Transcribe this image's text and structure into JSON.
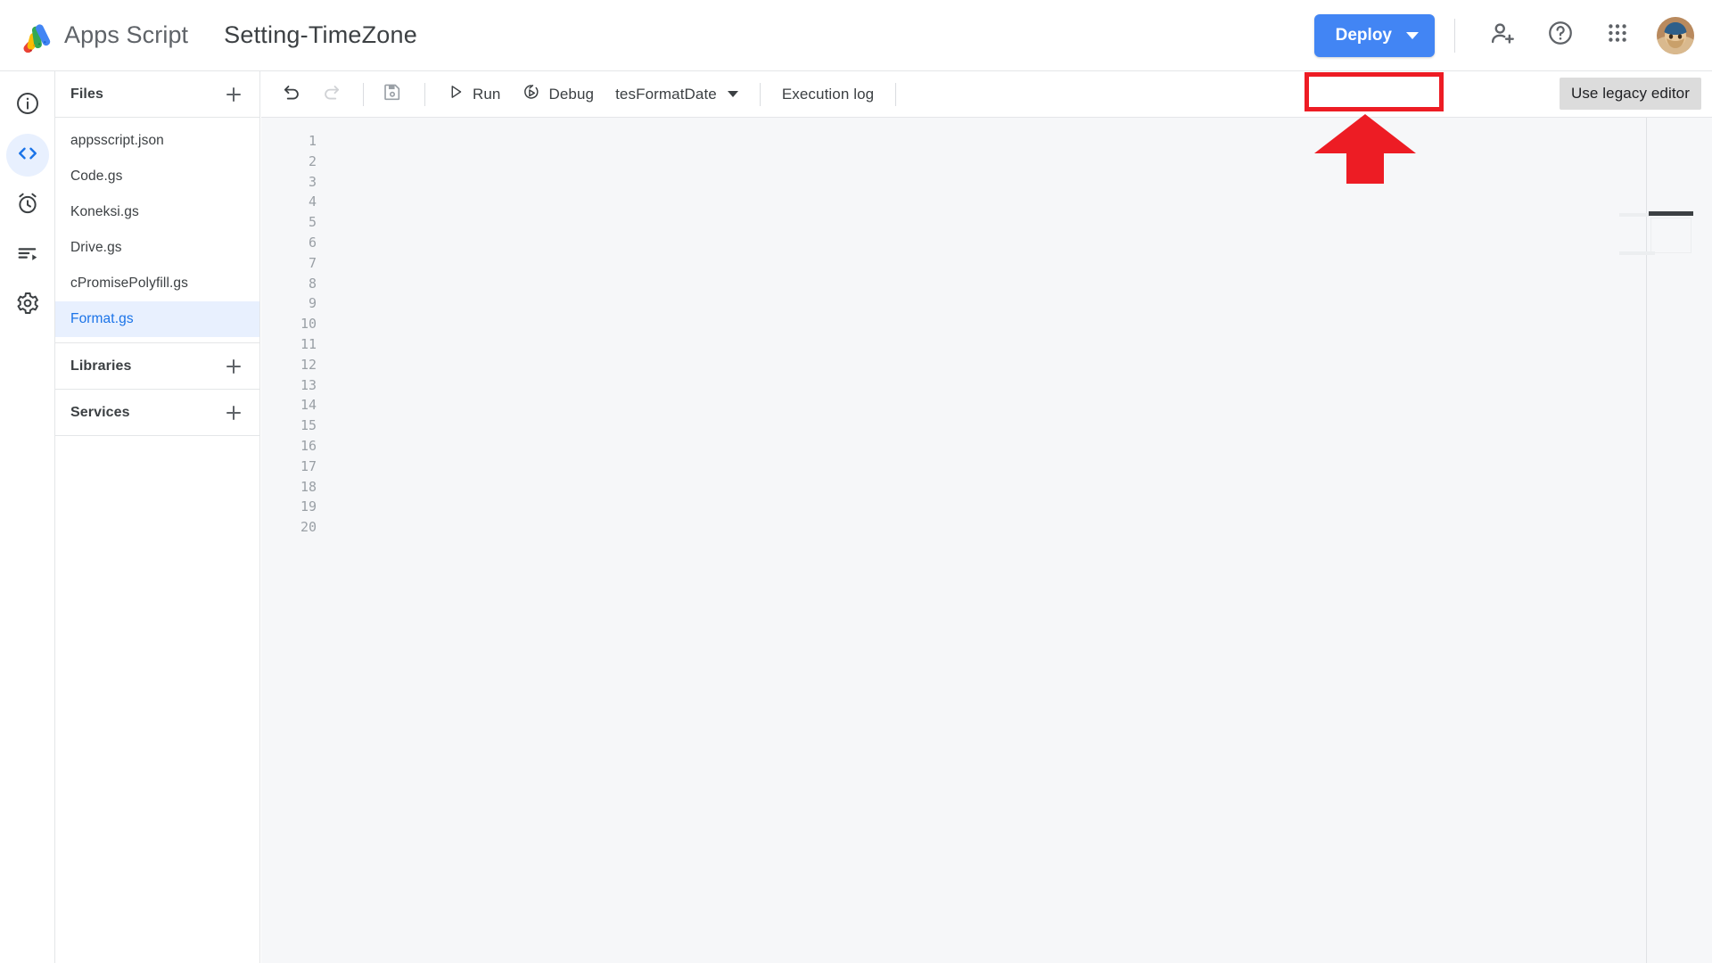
{
  "appbar": {
    "logo_icon": "apps-script-logo",
    "brand_name": "Apps Script",
    "project_title": "Setting-TimeZone",
    "deploy_label": "Deploy",
    "deploy_color": "#4285f4",
    "icons": {
      "add_person": "person-add-icon",
      "help": "help-circle-icon",
      "apps_grid": "apps-grid-icon",
      "avatar": "user-avatar"
    }
  },
  "rail": {
    "items": [
      {
        "icon": "info-icon",
        "name": "overview",
        "active": false
      },
      {
        "icon": "code-icon",
        "name": "editor",
        "active": true
      },
      {
        "icon": "alarm-clock-icon",
        "name": "triggers",
        "active": false
      },
      {
        "icon": "executions-icon",
        "name": "executions",
        "active": false
      },
      {
        "icon": "gear-icon",
        "name": "project-settings",
        "active": false
      }
    ],
    "active_bg": "#e8f0fe",
    "active_fg": "#1a73e8"
  },
  "files_panel": {
    "files_header": "Files",
    "add_file_icon": "plus-icon",
    "files": [
      {
        "name": "appsscript.json",
        "selected": false
      },
      {
        "name": "Code.gs",
        "selected": false
      },
      {
        "name": "Koneksi.gs",
        "selected": false
      },
      {
        "name": "Drive.gs",
        "selected": false
      },
      {
        "name": "cPromisePolyfill.gs",
        "selected": false
      },
      {
        "name": "Format.gs",
        "selected": true
      }
    ],
    "libraries_header": "Libraries",
    "add_library_icon": "plus-icon",
    "services_header": "Services",
    "add_service_icon": "plus-icon",
    "selected_bg": "#e8f0fe",
    "selected_fg": "#1a73e8"
  },
  "editor_toolbar": {
    "undo_icon": "undo-icon",
    "redo_icon": "redo-icon",
    "save_icon": "save-icon",
    "run_label": "Run",
    "run_icon": "play-triangle-icon",
    "debug_label": "Debug",
    "debug_icon": "debug-icon",
    "function_selected": "tesFormatDate",
    "function_caret_icon": "chevron-down-icon",
    "execution_log_label": "Execution log",
    "legacy_editor_label": "Use legacy editor"
  },
  "editor": {
    "line_numbers": [
      1,
      2,
      3,
      4,
      5,
      6,
      7,
      8,
      9,
      10,
      11,
      12,
      13,
      14,
      15,
      16,
      17,
      18,
      19,
      20
    ],
    "code_lines": [
      "",
      "",
      "",
      "",
      "",
      "",
      "",
      "",
      "",
      "",
      "",
      "",
      "",
      "",
      "",
      "",
      "",
      "",
      "",
      ""
    ],
    "background": "#f6f7f9",
    "gutter_color": "#9aa0a6"
  },
  "annotations": {
    "highlight_color": "#ed1c24",
    "highlight_target": "use-legacy-editor-button",
    "arrow_icon": "up-arrow-annotation",
    "arrow_direction": "up"
  }
}
